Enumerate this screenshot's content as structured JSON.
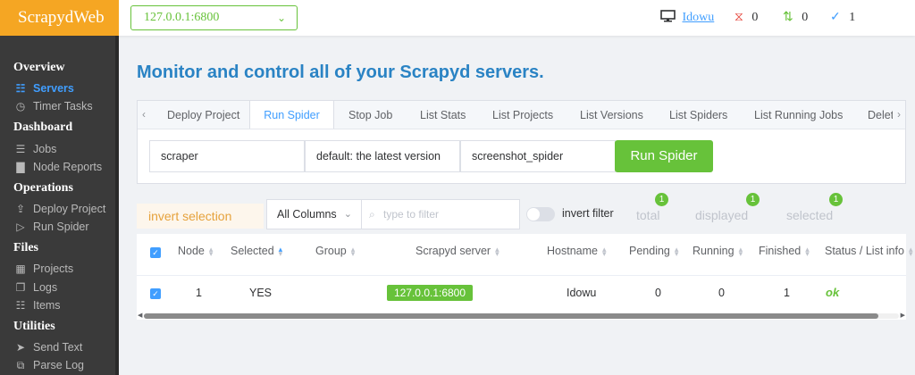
{
  "app": {
    "title": "ScrapydWeb"
  },
  "server_select": {
    "value": "127.0.0.1:6800"
  },
  "user": {
    "name": "Idowu"
  },
  "stats": {
    "pending": "0",
    "running": "0",
    "finished": "1"
  },
  "sidebar": {
    "sections": [
      {
        "label": "Overview",
        "items": [
          {
            "label": "Servers",
            "icon": "sitemap-icon",
            "active": true
          },
          {
            "label": "Timer Tasks",
            "icon": "timer-icon"
          }
        ]
      },
      {
        "label": "Dashboard",
        "items": [
          {
            "label": "Jobs",
            "icon": "jobs-icon"
          },
          {
            "label": "Node Reports",
            "icon": "chart-icon"
          }
        ]
      },
      {
        "label": "Operations",
        "items": [
          {
            "label": "Deploy Project",
            "icon": "upload-icon"
          },
          {
            "label": "Run Spider",
            "icon": "play-icon"
          }
        ]
      },
      {
        "label": "Files",
        "items": [
          {
            "label": "Projects",
            "icon": "projects-icon"
          },
          {
            "label": "Logs",
            "icon": "document-icon"
          },
          {
            "label": "Items",
            "icon": "list-icon"
          }
        ]
      },
      {
        "label": "Utilities",
        "items": [
          {
            "label": "Send Text",
            "icon": "send-icon"
          },
          {
            "label": "Parse Log",
            "icon": "parse-icon"
          }
        ]
      }
    ]
  },
  "main": {
    "title": "Monitor and control all of your Scrapyd servers.",
    "tabs": [
      "Deploy Project",
      "Run Spider",
      "Stop Job",
      "List Stats",
      "List Projects",
      "List Versions",
      "List Spiders",
      "List Running Jobs",
      "Delet"
    ],
    "active_tab": "Run Spider",
    "form": {
      "project": "scraper",
      "version": "default: the latest version",
      "spider": "screenshot_spider",
      "run_label": "Run Spider"
    }
  },
  "filter": {
    "invert_selection": "invert selection",
    "columns": "All Columns",
    "placeholder": "type to filter",
    "invert_filter": "invert filter",
    "total_label": "total",
    "total": "1",
    "displayed_label": "displayed",
    "displayed": "1",
    "selected_label": "selected",
    "selected": "1"
  },
  "table": {
    "headers": [
      "Node",
      "Selected",
      "Group",
      "Scrapyd server",
      "Hostname",
      "Pending",
      "Running",
      "Finished",
      "Status / List info"
    ],
    "rows": [
      {
        "node": "1",
        "selected": "YES",
        "group": "",
        "server": "127.0.0.1:6800",
        "hostname": "Idowu",
        "pending": "0",
        "running": "0",
        "finished": "1",
        "status": "ok"
      }
    ]
  },
  "colors": {
    "accent": "#409eff",
    "brand": "#f5a623",
    "success": "#67c23a",
    "title": "#2a83c4"
  }
}
